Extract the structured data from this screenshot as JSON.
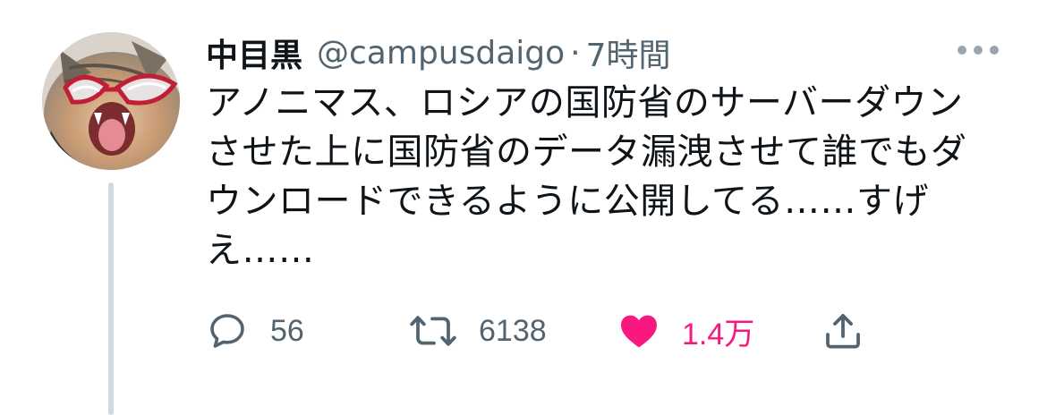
{
  "tweet": {
    "display_name": "中目黒",
    "handle": "@campusdaigo",
    "separator": "·",
    "time": "7時間",
    "text_lines": [
      "アノニマス、ロシアの国防省のサーバーダウン",
      "させた上に国防省のデータ漏洩させて誰でもダ",
      "ウンロードできるように公開してる……すげ",
      "え……"
    ]
  },
  "actions": {
    "reply_count": "56",
    "retweet_count": "6138",
    "like_count": "1.4万"
  },
  "icons": {
    "reply": "speech-bubble-icon",
    "retweet": "retweet-arrows-icon",
    "like": "heart-icon",
    "share": "share-upload-icon",
    "more": "more-horizontal-icon"
  },
  "colors": {
    "text_primary": "#0f1419",
    "text_secondary": "#536471",
    "like_pink": "#f91880",
    "thread_line": "#cfd9de"
  }
}
